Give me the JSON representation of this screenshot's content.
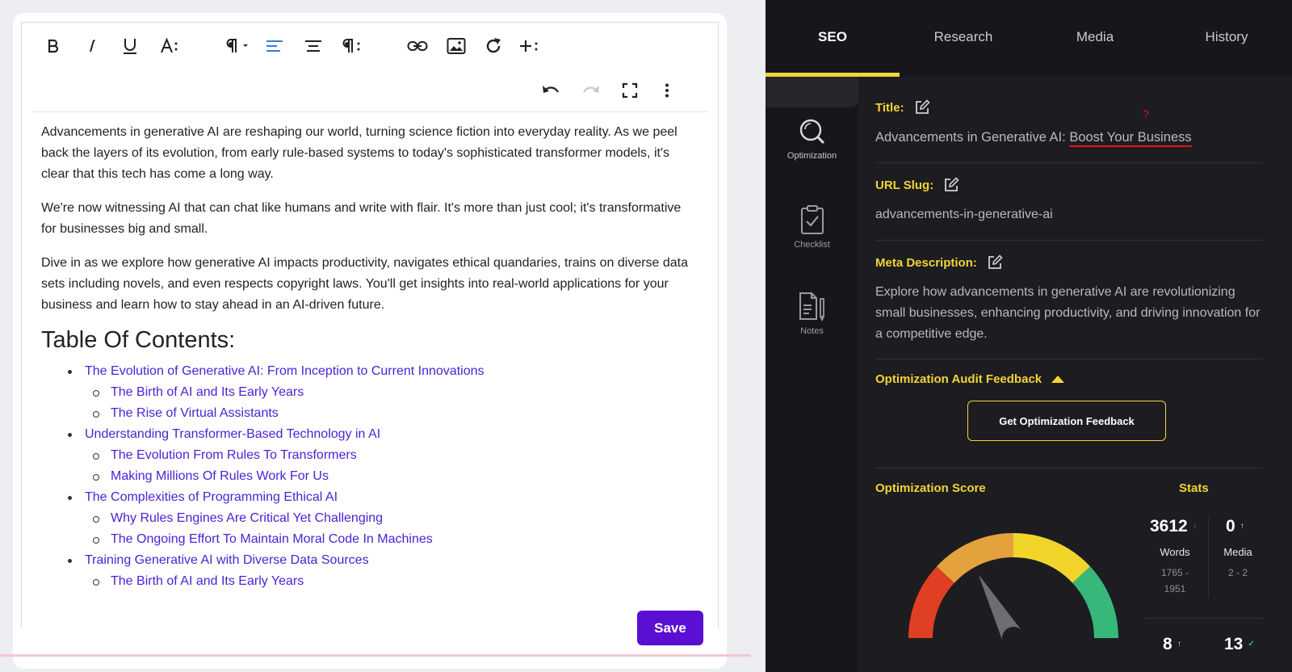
{
  "editor": {
    "paragraphs": [
      "Advancements in generative AI are reshaping our world, turning science fiction into everyday reality. As we peel back the layers of its evolution, from early rule-based systems to today's sophisticated transformer models, it's clear that this tech has come a long way.",
      "We're now witnessing AI that can chat like humans and write with flair. It's more than just cool; it's transformative for businesses big and small.",
      "Dive in as we explore how generative AI impacts productivity, navigates ethical quandaries, trains on diverse data sets including novels, and even respects copyright laws. You'll get insights into real-world applications for your business and learn how to stay ahead in an AI-driven future."
    ],
    "toc_heading": "Table Of Contents:",
    "toc": [
      {
        "label": "The Evolution of Generative AI: From Inception to Current Innovations",
        "children": [
          "The Birth of AI and Its Early Years",
          "The Rise of Virtual Assistants"
        ]
      },
      {
        "label": "Understanding Transformer-Based Technology in AI",
        "children": [
          "The Evolution From Rules To Transformers",
          "Making Millions Of Rules Work For Us"
        ]
      },
      {
        "label": "The Complexities of Programming Ethical AI",
        "children": [
          "Why Rules Engines Are Critical Yet Challenging",
          "The Ongoing Effort To Maintain Moral Code In Machines"
        ]
      },
      {
        "label": "Training Generative AI with Diverse Data Sources",
        "children": [
          "The Birth of AI and Its Early Years"
        ]
      }
    ],
    "save_label": "Save",
    "toolbar_icons": [
      "bold-icon",
      "italic-icon",
      "underline-icon",
      "font-size-icon",
      "paragraph-format-icon",
      "align-left-icon",
      "align-center-icon",
      "paragraph-style-icon",
      "link-icon",
      "image-icon",
      "redo-refresh-icon",
      "more-insert-icon",
      "undo-icon",
      "redo-icon",
      "fullscreen-icon",
      "more-vertical-icon"
    ]
  },
  "panel": {
    "tabs": [
      "SEO",
      "Research",
      "Media",
      "History"
    ],
    "active_tab": "SEO",
    "side_nav": [
      {
        "label": "Optimization",
        "icon": "magnifier-icon"
      },
      {
        "label": "Checklist",
        "icon": "checklist-icon"
      },
      {
        "label": "Notes",
        "icon": "notes-icon"
      }
    ],
    "title_label": "Title:",
    "title_value_plain": "Advancements in Generative AI: ",
    "title_value_marked": "Boost Your Business",
    "title_mark": "?",
    "slug_label": "URL Slug:",
    "slug_value": "advancements-in-generative-ai",
    "meta_label": "Meta Description:",
    "meta_value": "Explore how advancements in generative AI are revolutionizing small businesses, enhancing productivity, and driving innovation for a competitive edge.",
    "audit_label": "Optimization Audit Feedback",
    "feedback_button": "Get Optimization Feedback",
    "score_label": "Optimization Score",
    "stats_label": "Stats",
    "gauge_level": 0.34,
    "stats": {
      "words": {
        "value": "3612",
        "arrow": "↓",
        "label": "Words",
        "range_a": "1765 -",
        "range_b": "1951"
      },
      "media": {
        "value": "0",
        "arrow": "↑",
        "label": "Media",
        "range_a": "2 - 2"
      },
      "stat3": {
        "value": "8",
        "arrow": "↑"
      },
      "stat4": {
        "value": "13",
        "arrow": "✓"
      }
    },
    "colors": {
      "accent": "#f3d437",
      "gauge_red": "#df3f22",
      "gauge_orange": "#e4a23c",
      "gauge_yellow": "#f2d52b",
      "gauge_green": "#37b87a",
      "save": "#5a0fd3"
    }
  }
}
